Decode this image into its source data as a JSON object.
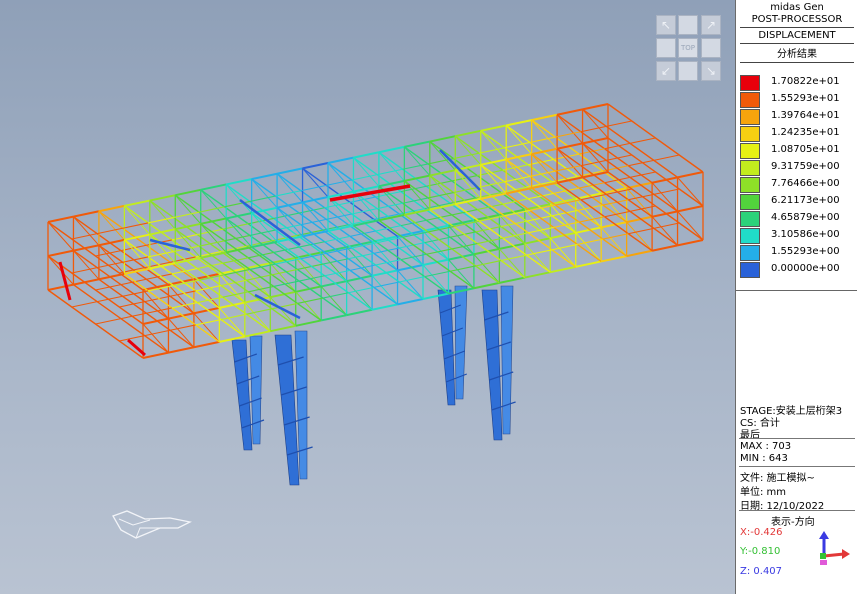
{
  "app": {
    "title": "midas Gen",
    "subtitle": "POST-PROCESSOR"
  },
  "result": {
    "type": "DISPLACEMENT",
    "heading": "分析结果"
  },
  "legend": {
    "entries": [
      {
        "value": "1.70822e+01",
        "color": "#e8000b"
      },
      {
        "value": "1.55293e+01",
        "color": "#f05a0a"
      },
      {
        "value": "1.39764e+01",
        "color": "#f7a40d"
      },
      {
        "value": "1.24235e+01",
        "color": "#f7cf12"
      },
      {
        "value": "1.08705e+01",
        "color": "#e6f014"
      },
      {
        "value": "9.31759e+00",
        "color": "#c2ec1e"
      },
      {
        "value": "7.76466e+00",
        "color": "#8ee028"
      },
      {
        "value": "6.21173e+00",
        "color": "#52d43c"
      },
      {
        "value": "4.65879e+00",
        "color": "#2cd27a"
      },
      {
        "value": "3.10586e+00",
        "color": "#20dcc8"
      },
      {
        "value": "1.55293e+00",
        "color": "#24aee8"
      },
      {
        "value": "0.00000e+00",
        "color": "#2a62d8"
      }
    ]
  },
  "info": {
    "stage": "STAGE:安装上层桁架3",
    "cs": "CS: 合计",
    "phase": "最后",
    "max": "MAX : 703",
    "min": "MIN : 643",
    "file": "文件: 施工模拟~",
    "unit": "单位: mm",
    "date": "日期: 12/10/2022",
    "view_dir": "表示-方向"
  },
  "direction": {
    "x": {
      "label": "X:-0.426",
      "color": "#e23838"
    },
    "y": {
      "label": "Y:-0.810",
      "color": "#34c034"
    },
    "z": {
      "label": "Z: 0.407",
      "color": "#3a3ae2"
    }
  },
  "view_cube": {
    "top_label": "TOP"
  }
}
